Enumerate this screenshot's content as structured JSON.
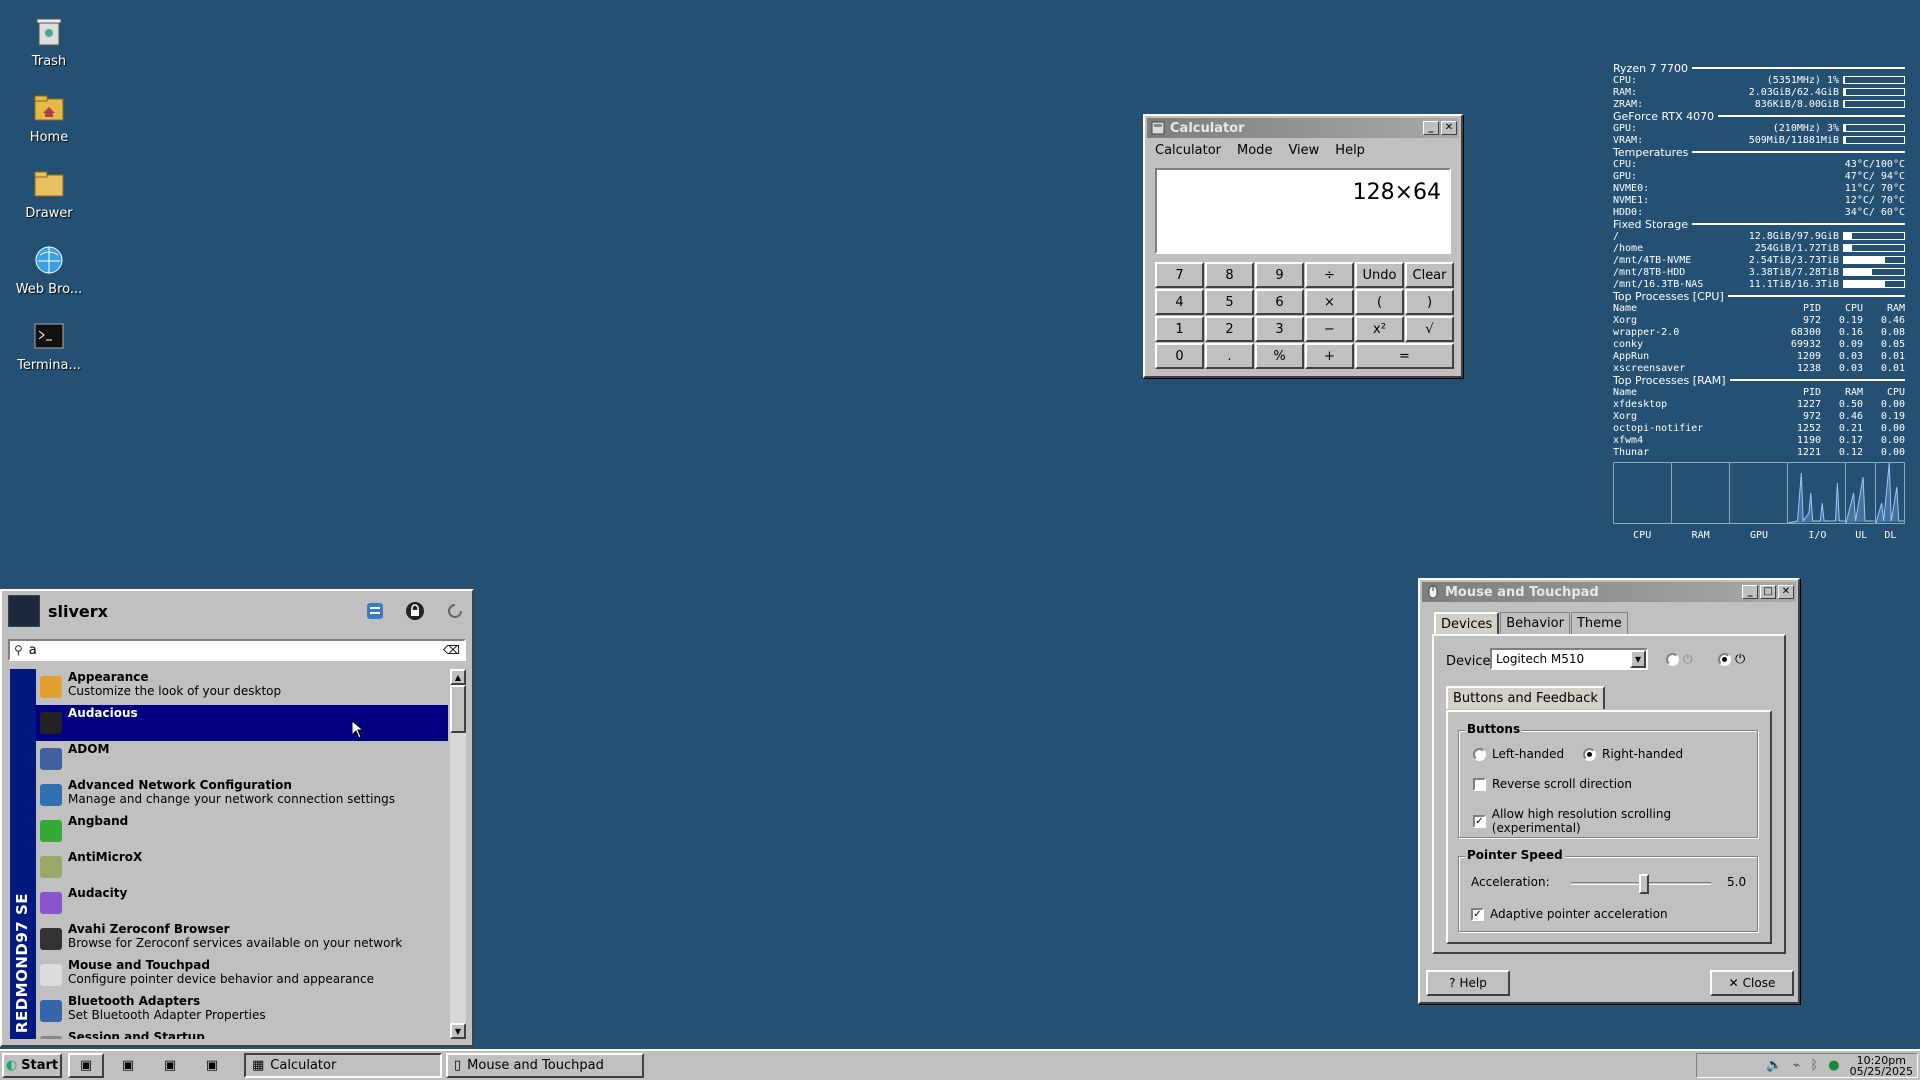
{
  "desktop": {
    "icons": [
      {
        "label": "Trash"
      },
      {
        "label": "Home"
      },
      {
        "label": "Drawer"
      },
      {
        "label": "Web Bro..."
      },
      {
        "label": "Termina..."
      }
    ]
  },
  "calculator": {
    "title": "Calculator",
    "menu": [
      "Calculator",
      "Mode",
      "View",
      "Help"
    ],
    "display": "128×64",
    "buttons": [
      "7",
      "8",
      "9",
      "÷",
      "Undo",
      "Clear",
      "4",
      "5",
      "6",
      "×",
      "(",
      ")",
      "1",
      "2",
      "3",
      "−",
      "x²",
      "√",
      "0",
      ".",
      "%",
      "+",
      "="
    ]
  },
  "conky": {
    "cpu_name": "Ryzen 7 7700",
    "cpu": {
      "label": "CPU:",
      "value": "(5351MHz) 1%",
      "pct": 1
    },
    "ram": {
      "label": "RAM:",
      "value": "2.03GiB/62.4GiB",
      "pct": 3
    },
    "zram": {
      "label": "ZRAM:",
      "value": "836KiB/8.00GiB",
      "pct": 0
    },
    "gpu_name": "GeForce RTX 4070",
    "gpu": {
      "label": "GPU:",
      "value": "(210MHz) 3%",
      "pct": 3
    },
    "vram": {
      "label": "VRAM:",
      "value": "509MiB/11881MiB",
      "pct": 4
    },
    "temps_title": "Temperatures",
    "temps": [
      {
        "k": "CPU:",
        "v": "43°C/100°C"
      },
      {
        "k": "GPU:",
        "v": "47°C/ 94°C"
      },
      {
        "k": "NVME0:",
        "v": "11°C/ 70°C"
      },
      {
        "k": "NVME1:",
        "v": "12°C/ 70°C"
      },
      {
        "k": "HDD0:",
        "v": "34°C/ 60°C"
      }
    ],
    "storage_title": "Fixed Storage",
    "storage": [
      {
        "k": "/",
        "v": "12.8GiB/97.9GiB",
        "pct": 13
      },
      {
        "k": "/home",
        "v": "254GiB/1.72TiB",
        "pct": 14
      },
      {
        "k": "/mnt/4TB-NVME",
        "v": "2.54TiB/3.73TiB",
        "pct": 68
      },
      {
        "k": "/mnt/8TB-HDD",
        "v": "3.38TiB/7.28TiB",
        "pct": 46
      },
      {
        "k": "/mnt/16.3TB-NAS",
        "v": "11.1TiB/16.3TiB",
        "pct": 68
      }
    ],
    "top_cpu_title": "Top Processes [CPU]",
    "top_cpu_header": {
      "n": "Name",
      "a": "PID",
      "b": "CPU",
      "c": "RAM"
    },
    "top_cpu": [
      {
        "n": "Xorg",
        "a": "972",
        "b": "0.19",
        "c": "0.46"
      },
      {
        "n": "wrapper-2.0",
        "a": "68300",
        "b": "0.16",
        "c": "0.08"
      },
      {
        "n": "conky",
        "a": "69932",
        "b": "0.09",
        "c": "0.05"
      },
      {
        "n": "AppRun",
        "a": "1209",
        "b": "0.03",
        "c": "0.01"
      },
      {
        "n": "xscreensaver",
        "a": "1238",
        "b": "0.03",
        "c": "0.01"
      }
    ],
    "top_ram_title": "Top Processes [RAM]",
    "top_ram_header": {
      "n": "Name",
      "a": "PID",
      "b": "RAM",
      "c": "CPU"
    },
    "top_ram": [
      {
        "n": "xfdesktop",
        "a": "1227",
        "b": "0.50",
        "c": "0.00"
      },
      {
        "n": "Xorg",
        "a": "972",
        "b": "0.46",
        "c": "0.19"
      },
      {
        "n": "octopi-notifier",
        "a": "1252",
        "b": "0.21",
        "c": "0.00"
      },
      {
        "n": "xfwm4",
        "a": "1190",
        "b": "0.17",
        "c": "0.00"
      },
      {
        "n": "Thunar",
        "a": "1221",
        "b": "0.12",
        "c": "0.00"
      }
    ],
    "graph_labels": [
      "CPU",
      "RAM",
      "GPU",
      "I/O",
      "UL",
      "DL"
    ]
  },
  "mouse": {
    "title": "Mouse and Touchpad",
    "tabs": [
      "Devices",
      "Behavior",
      "Theme"
    ],
    "device_label": "Device:",
    "device_value": "Logitech M510",
    "subtab": "Buttons and Feedback",
    "buttons_group": "Buttons",
    "left_handed": "Left-handed",
    "right_handed": "Right-handed",
    "reverse_scroll": "Reverse scroll direction",
    "high_res": "Allow high resolution scrolling (experimental)",
    "speed_group": "Pointer Speed",
    "accel_label": "Acceleration:",
    "accel_value": "5.0",
    "adaptive": "Adaptive pointer acceleration",
    "help": "Help",
    "close": "Close"
  },
  "startmenu": {
    "user": "sliverx",
    "search_value": "a",
    "side_label": "REDMOND97 SE",
    "items": [
      {
        "name": "Appearance",
        "desc": "Customize the look of your desktop"
      },
      {
        "name": "Audacious",
        "desc": ""
      },
      {
        "name": "ADOM",
        "desc": ""
      },
      {
        "name": "Advanced Network Configuration",
        "desc": "Manage and change your network connection settings"
      },
      {
        "name": "Angband",
        "desc": ""
      },
      {
        "name": "AntiMicroX",
        "desc": ""
      },
      {
        "name": "Audacity",
        "desc": ""
      },
      {
        "name": "Avahi Zeroconf Browser",
        "desc": "Browse for Zeroconf services available on your network"
      },
      {
        "name": "Mouse and Touchpad",
        "desc": "Configure pointer device behavior and appearance"
      },
      {
        "name": "Bluetooth Adapters",
        "desc": "Set Bluetooth Adapter Properties"
      },
      {
        "name": "Session and Startup",
        "desc": ""
      }
    ]
  },
  "taskbar": {
    "start": "Start",
    "tasks": [
      "Calculator",
      "Mouse and Touchpad"
    ],
    "time": "10:20pm",
    "date": "05/25/2025"
  }
}
